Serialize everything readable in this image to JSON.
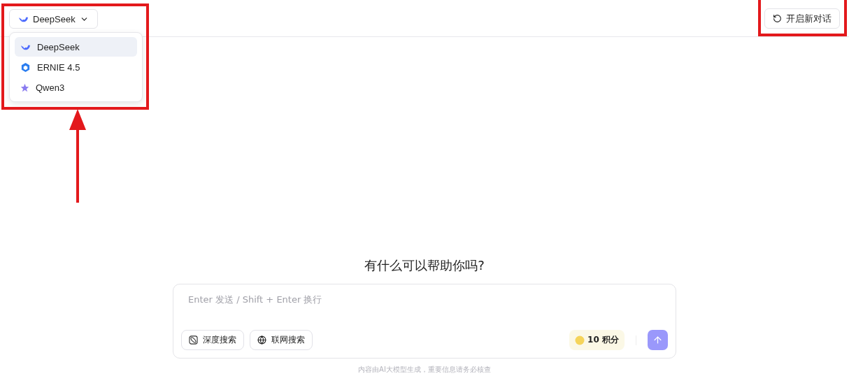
{
  "model_selector": {
    "label": "DeepSeek",
    "expanded": true
  },
  "models": [
    {
      "label": "DeepSeek",
      "selected": true
    },
    {
      "label": "ERNIE 4.5",
      "selected": false
    },
    {
      "label": "Qwen3",
      "selected": false
    }
  ],
  "new_chat_button": "开启新对话",
  "greeting": "有什么可以帮助你吗?",
  "composer": {
    "placeholder": "Enter 发送 / Shift + Enter 换行",
    "tools": [
      "深度搜索",
      "联网搜索"
    ],
    "points": "10 积分"
  },
  "disclaimer": "内容由AI大模型生成，重要信息请务必核查"
}
